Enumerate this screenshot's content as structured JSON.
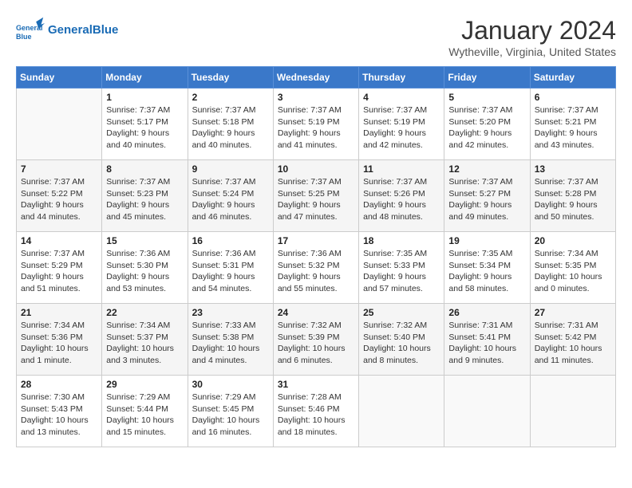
{
  "header": {
    "logo_line1": "General",
    "logo_line2": "Blue",
    "title": "January 2024",
    "location": "Wytheville, Virginia, United States"
  },
  "days_of_week": [
    "Sunday",
    "Monday",
    "Tuesday",
    "Wednesday",
    "Thursday",
    "Friday",
    "Saturday"
  ],
  "weeks": [
    [
      {
        "num": "",
        "info": ""
      },
      {
        "num": "1",
        "info": "Sunrise: 7:37 AM\nSunset: 5:17 PM\nDaylight: 9 hours\nand 40 minutes."
      },
      {
        "num": "2",
        "info": "Sunrise: 7:37 AM\nSunset: 5:18 PM\nDaylight: 9 hours\nand 40 minutes."
      },
      {
        "num": "3",
        "info": "Sunrise: 7:37 AM\nSunset: 5:19 PM\nDaylight: 9 hours\nand 41 minutes."
      },
      {
        "num": "4",
        "info": "Sunrise: 7:37 AM\nSunset: 5:19 PM\nDaylight: 9 hours\nand 42 minutes."
      },
      {
        "num": "5",
        "info": "Sunrise: 7:37 AM\nSunset: 5:20 PM\nDaylight: 9 hours\nand 42 minutes."
      },
      {
        "num": "6",
        "info": "Sunrise: 7:37 AM\nSunset: 5:21 PM\nDaylight: 9 hours\nand 43 minutes."
      }
    ],
    [
      {
        "num": "7",
        "info": "Sunrise: 7:37 AM\nSunset: 5:22 PM\nDaylight: 9 hours\nand 44 minutes."
      },
      {
        "num": "8",
        "info": "Sunrise: 7:37 AM\nSunset: 5:23 PM\nDaylight: 9 hours\nand 45 minutes."
      },
      {
        "num": "9",
        "info": "Sunrise: 7:37 AM\nSunset: 5:24 PM\nDaylight: 9 hours\nand 46 minutes."
      },
      {
        "num": "10",
        "info": "Sunrise: 7:37 AM\nSunset: 5:25 PM\nDaylight: 9 hours\nand 47 minutes."
      },
      {
        "num": "11",
        "info": "Sunrise: 7:37 AM\nSunset: 5:26 PM\nDaylight: 9 hours\nand 48 minutes."
      },
      {
        "num": "12",
        "info": "Sunrise: 7:37 AM\nSunset: 5:27 PM\nDaylight: 9 hours\nand 49 minutes."
      },
      {
        "num": "13",
        "info": "Sunrise: 7:37 AM\nSunset: 5:28 PM\nDaylight: 9 hours\nand 50 minutes."
      }
    ],
    [
      {
        "num": "14",
        "info": "Sunrise: 7:37 AM\nSunset: 5:29 PM\nDaylight: 9 hours\nand 51 minutes."
      },
      {
        "num": "15",
        "info": "Sunrise: 7:36 AM\nSunset: 5:30 PM\nDaylight: 9 hours\nand 53 minutes."
      },
      {
        "num": "16",
        "info": "Sunrise: 7:36 AM\nSunset: 5:31 PM\nDaylight: 9 hours\nand 54 minutes."
      },
      {
        "num": "17",
        "info": "Sunrise: 7:36 AM\nSunset: 5:32 PM\nDaylight: 9 hours\nand 55 minutes."
      },
      {
        "num": "18",
        "info": "Sunrise: 7:35 AM\nSunset: 5:33 PM\nDaylight: 9 hours\nand 57 minutes."
      },
      {
        "num": "19",
        "info": "Sunrise: 7:35 AM\nSunset: 5:34 PM\nDaylight: 9 hours\nand 58 minutes."
      },
      {
        "num": "20",
        "info": "Sunrise: 7:34 AM\nSunset: 5:35 PM\nDaylight: 10 hours\nand 0 minutes."
      }
    ],
    [
      {
        "num": "21",
        "info": "Sunrise: 7:34 AM\nSunset: 5:36 PM\nDaylight: 10 hours\nand 1 minute."
      },
      {
        "num": "22",
        "info": "Sunrise: 7:34 AM\nSunset: 5:37 PM\nDaylight: 10 hours\nand 3 minutes."
      },
      {
        "num": "23",
        "info": "Sunrise: 7:33 AM\nSunset: 5:38 PM\nDaylight: 10 hours\nand 4 minutes."
      },
      {
        "num": "24",
        "info": "Sunrise: 7:32 AM\nSunset: 5:39 PM\nDaylight: 10 hours\nand 6 minutes."
      },
      {
        "num": "25",
        "info": "Sunrise: 7:32 AM\nSunset: 5:40 PM\nDaylight: 10 hours\nand 8 minutes."
      },
      {
        "num": "26",
        "info": "Sunrise: 7:31 AM\nSunset: 5:41 PM\nDaylight: 10 hours\nand 9 minutes."
      },
      {
        "num": "27",
        "info": "Sunrise: 7:31 AM\nSunset: 5:42 PM\nDaylight: 10 hours\nand 11 minutes."
      }
    ],
    [
      {
        "num": "28",
        "info": "Sunrise: 7:30 AM\nSunset: 5:43 PM\nDaylight: 10 hours\nand 13 minutes."
      },
      {
        "num": "29",
        "info": "Sunrise: 7:29 AM\nSunset: 5:44 PM\nDaylight: 10 hours\nand 15 minutes."
      },
      {
        "num": "30",
        "info": "Sunrise: 7:29 AM\nSunset: 5:45 PM\nDaylight: 10 hours\nand 16 minutes."
      },
      {
        "num": "31",
        "info": "Sunrise: 7:28 AM\nSunset: 5:46 PM\nDaylight: 10 hours\nand 18 minutes."
      },
      {
        "num": "",
        "info": ""
      },
      {
        "num": "",
        "info": ""
      },
      {
        "num": "",
        "info": ""
      }
    ]
  ]
}
